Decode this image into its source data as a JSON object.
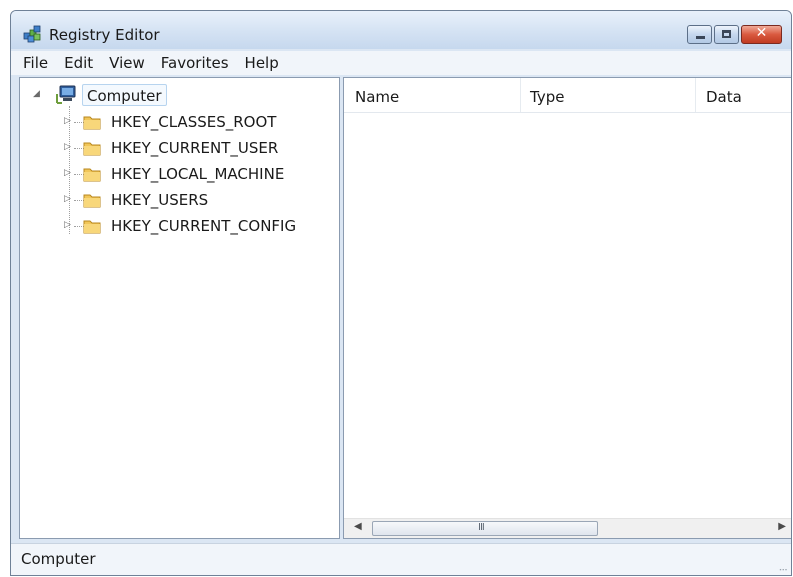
{
  "window": {
    "title": "Registry Editor",
    "icon": "registry-editor-icon",
    "controls": {
      "minimize": "minimize",
      "maximize": "maximize",
      "close": "close"
    }
  },
  "menu": [
    {
      "label": "File"
    },
    {
      "label": "Edit"
    },
    {
      "label": "View"
    },
    {
      "label": "Favorites"
    },
    {
      "label": "Help"
    }
  ],
  "tree": {
    "root": {
      "label": "Computer",
      "icon": "computer-icon",
      "expanded": true,
      "selected": true
    },
    "children": [
      {
        "label": "HKEY_CLASSES_ROOT",
        "icon": "folder-icon"
      },
      {
        "label": "HKEY_CURRENT_USER",
        "icon": "folder-icon"
      },
      {
        "label": "HKEY_LOCAL_MACHINE",
        "icon": "folder-icon"
      },
      {
        "label": "HKEY_USERS",
        "icon": "folder-icon"
      },
      {
        "label": "HKEY_CURRENT_CONFIG",
        "icon": "folder-icon"
      }
    ]
  },
  "list": {
    "columns": [
      "Name",
      "Type",
      "Data"
    ],
    "rows": []
  },
  "scrollbar": {
    "grip": "III"
  },
  "status": {
    "text": "Computer"
  },
  "colors": {
    "titlebar": "#d4e2f3",
    "close_button": "#d9593f",
    "selection_border": "#b7d4ef"
  }
}
